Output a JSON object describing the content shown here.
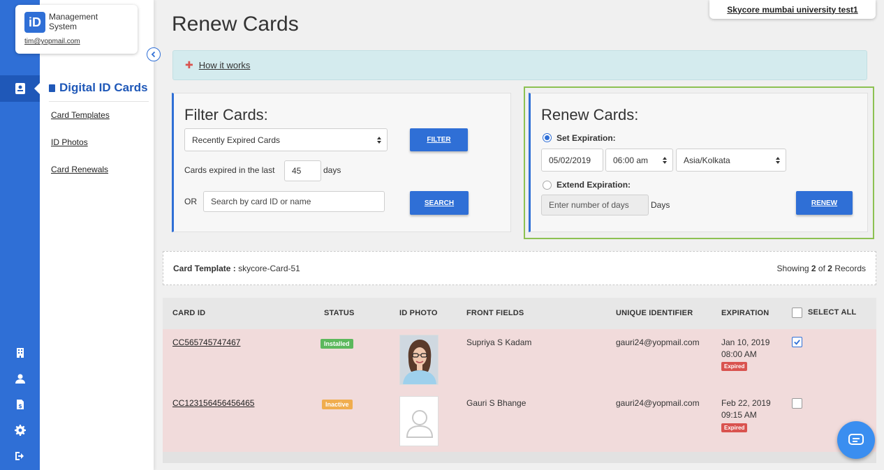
{
  "app": {
    "logo_badge": "iD",
    "logo_line1": "Management",
    "logo_line2": "System",
    "user_email": "tim@yopmail.com",
    "organization": "Skycore mumbai university test1"
  },
  "rail": {
    "active_icon": "id-card-icon",
    "bottom_icons": [
      "building-icon",
      "user-icon",
      "document-dollar-icon",
      "gear-icon",
      "logout-icon"
    ]
  },
  "subnav": {
    "title": "Digital ID Cards",
    "items": [
      {
        "label": "Card Templates"
      },
      {
        "label": "ID Photos"
      },
      {
        "label": "Card Renewals"
      }
    ]
  },
  "page": {
    "title": "Renew Cards",
    "how_it_works": "How it works"
  },
  "filter": {
    "heading": "Filter Cards:",
    "select_value": "Recently Expired Cards",
    "filter_button": "FILTER",
    "expired_prefix": "Cards expired in the last",
    "days_value": "45",
    "expired_suffix": "days",
    "or_label": "OR",
    "search_placeholder": "Search by card ID or name",
    "search_button": "SEARCH"
  },
  "renew": {
    "heading": "Renew Cards:",
    "set_expiration_label": "Set Expiration:",
    "date_value": "05/02/2019",
    "time_value": "06:00 am",
    "timezone_value": "Asia/Kolkata",
    "extend_expiration_label": "Extend Expiration:",
    "days_placeholder": "Enter number of days",
    "days_label": "Days",
    "renew_button": "RENEW"
  },
  "template_bar": {
    "label": "Card Template :",
    "value": "skycore-Card-51",
    "showing_prefix": "Showing",
    "showing_count": "2",
    "showing_of": "of",
    "showing_total": "2",
    "showing_suffix": "Records"
  },
  "table": {
    "headers": {
      "card_id": "CARD ID",
      "status": "STATUS",
      "id_photo": "ID PHOTO",
      "front_fields": "FRONT FIELDS",
      "unique_identifier": "UNIQUE IDENTIFIER",
      "expiration": "EXPIRATION",
      "select_all": "SELECT ALL"
    },
    "rows": [
      {
        "card_id": "CC565745747467",
        "status": "Installed",
        "status_color": "#5cb85c",
        "front_fields": "Supriya S Kadam",
        "unique_identifier": "gauri24@yopmail.com",
        "expiration_date": "Jan 10, 2019",
        "expiration_time": "08:00 AM",
        "expiration_badge": "Expired",
        "checked": true
      },
      {
        "card_id": "CC123156456456465",
        "status": "Inactive",
        "status_color": "#f0ad4e",
        "front_fields": "Gauri S Bhange",
        "unique_identifier": "gauri24@yopmail.com",
        "expiration_date": "Feb 22, 2019",
        "expiration_time": "09:15 AM",
        "expiration_badge": "Expired",
        "checked": false
      }
    ]
  },
  "colors": {
    "primary": "#2f6fd6",
    "highlight": "#8cc152",
    "expired_row": "#f1dbdb"
  }
}
